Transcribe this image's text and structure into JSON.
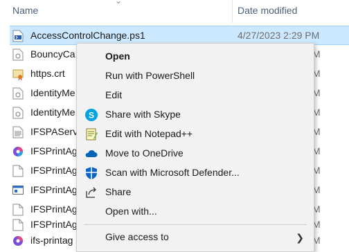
{
  "header": {
    "name": "Name",
    "date_modified": "Date modified"
  },
  "files": [
    {
      "name": "AccessControlChange.ps1",
      "date": "4/27/2023 2:29 PM",
      "icon": "ps1-file-icon",
      "selected": true
    },
    {
      "name": "BouncyCa",
      "date_tail": "M",
      "icon": "generic-file-icon"
    },
    {
      "name": "https.crt",
      "date_tail": "M",
      "icon": "certificate-icon"
    },
    {
      "name": "IdentityMe",
      "date_tail": "M",
      "icon": "generic-file-icon"
    },
    {
      "name": "IdentityMe",
      "date_tail": "M",
      "icon": "generic-file-icon"
    },
    {
      "name": "IFSPAServ",
      "date_tail": "M",
      "icon": "text-file-icon"
    },
    {
      "name": "IFSPrintAg",
      "date_tail": "M",
      "icon": "colorful-app-icon"
    },
    {
      "name": "IFSPrintAg",
      "date_tail": "M",
      "icon": "blank-file-icon"
    },
    {
      "name": "IFSPrintAg",
      "date_tail": "M",
      "icon": "exe-window-icon"
    },
    {
      "name": "IFSPrintAg",
      "date_tail": "M",
      "icon": "blank-file-icon"
    },
    {
      "name": "IFSPrintAg",
      "date_tail": "M",
      "icon": "blank-file-icon"
    },
    {
      "name": "ifs-printag",
      "date_tail": "M",
      "icon": "colorful-app-icon"
    }
  ],
  "menu": {
    "items": [
      {
        "label": "Open",
        "bold": true
      },
      {
        "label": "Run with PowerShell"
      },
      {
        "label": "Edit"
      },
      {
        "label": "Share with Skype",
        "icon": "skype-icon"
      },
      {
        "label": "Edit with Notepad++",
        "icon": "notepad-plus-plus-icon"
      },
      {
        "label": "Move to OneDrive",
        "icon": "onedrive-cloud-icon"
      },
      {
        "label": "Scan with Microsoft Defender...",
        "icon": "defender-shield-icon"
      },
      {
        "label": "Share",
        "icon": "share-icon"
      },
      {
        "label": "Open with..."
      },
      {
        "label": "Give access to",
        "submenu": true
      }
    ]
  },
  "colors": {
    "selection": "#cce8ff",
    "menu_bg": "#f2f2f2",
    "header_text": "#4c607a"
  }
}
